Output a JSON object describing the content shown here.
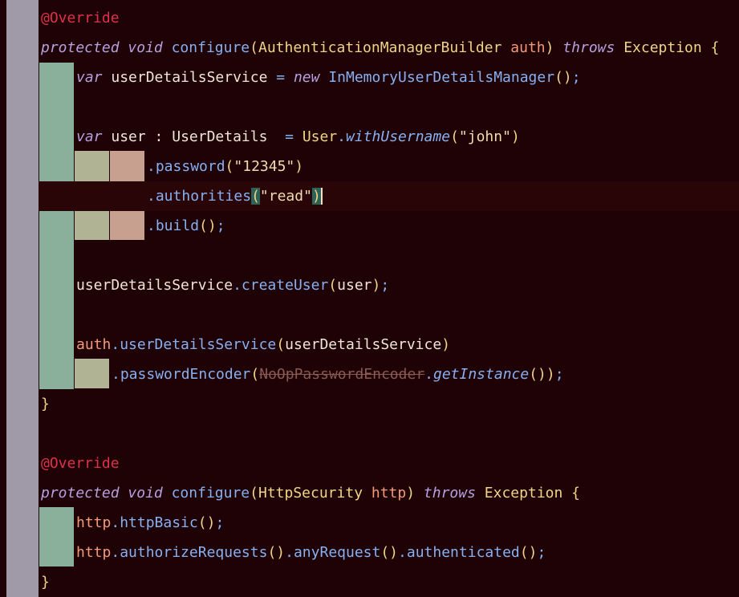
{
  "annotation": "@Override",
  "keywords": {
    "protected": "protected",
    "void": "void",
    "throws": "throws",
    "var": "var",
    "new": "new"
  },
  "method1": {
    "name": "configure",
    "param_type": "AuthenticationManagerBuilder",
    "param_name": "auth",
    "exception": "Exception",
    "line_uds_var": "userDetailsService",
    "class_imudm": "InMemoryUserDetailsManager",
    "user_var": "user",
    "user_type": "UserDetails",
    "user_class": "User",
    "with_username": "withUsername",
    "username": "\"john\"",
    "password_fn": "password",
    "password": "\"12345\"",
    "authorities_fn": "authorities",
    "authority": "\"read\"",
    "build_fn": "build",
    "create_user_fn": "createUser",
    "auth_var": "auth",
    "uds_fn": "userDetailsService",
    "password_encoder_fn": "passwordEncoder",
    "noop_class": "NoOpPasswordEncoder",
    "get_instance_fn": "getInstance"
  },
  "method2": {
    "name": "configure",
    "param_type": "HttpSecurity",
    "param_name": "http",
    "exception": "Exception",
    "http_var": "http",
    "http_basic_fn": "httpBasic",
    "authorize_requests_fn": "authorizeRequests",
    "any_request_fn": "anyRequest",
    "authenticated_fn": "authenticated"
  },
  "colors": {
    "background": "#1e0205",
    "gutter": "#a09aa8",
    "indent_1": "#8ab09c",
    "indent_2": "#b0b494",
    "indent_3": "#c8a090",
    "annotation": "#e0304a",
    "keyword": "#b8a0e0",
    "function": "#88b0f0",
    "class": "#f0d488",
    "parameter": "#f49a78"
  }
}
